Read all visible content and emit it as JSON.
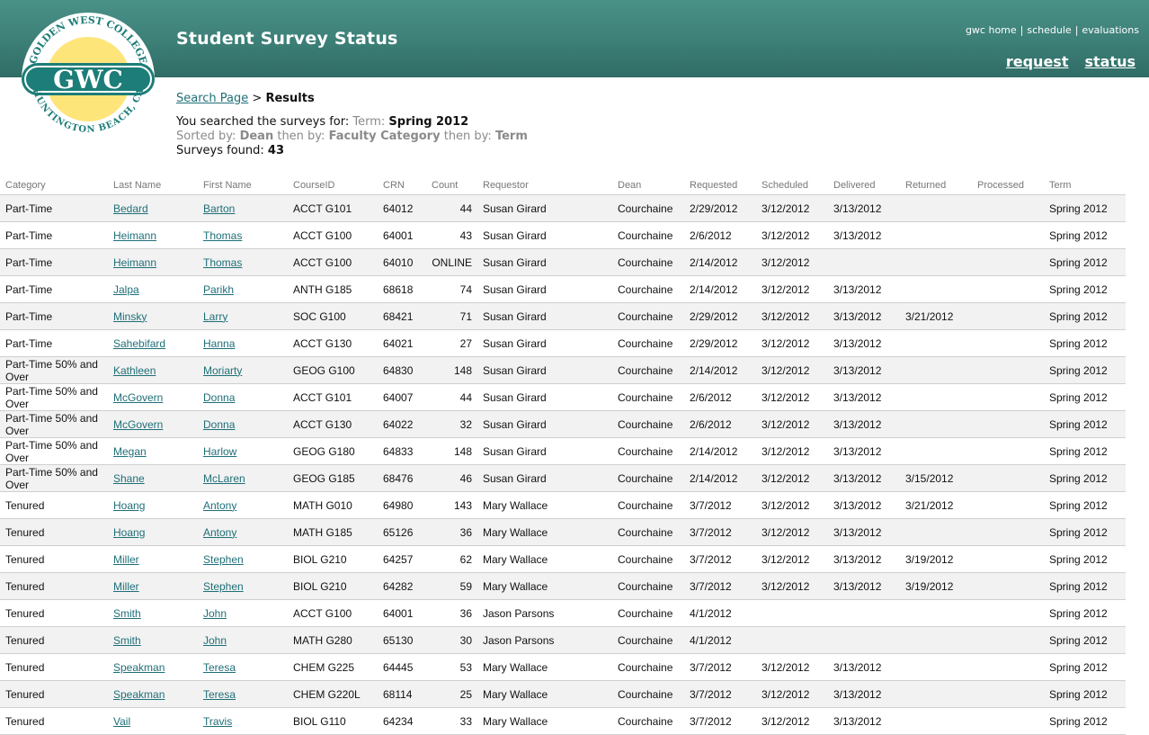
{
  "header": {
    "title": "Student Survey Status",
    "top_links": [
      "gwc home",
      "schedule",
      "evaluations"
    ],
    "top_sep": "|",
    "main_links": [
      "request",
      "status"
    ]
  },
  "logo": {
    "arc_top": "GOLDEN WEST COLLEGE",
    "center": "GWC",
    "arc_bottom": "HUNTINGTON BEACH, CA",
    "colors": {
      "sun": "#fde57a",
      "band": "#1d7d78",
      "ring": "#ffffff"
    }
  },
  "breadcrumb": {
    "link": "Search Page",
    "sep": ">",
    "current": "Results"
  },
  "search_info": {
    "line1_prefix": "You searched the surveys for:",
    "term_label": "Term:",
    "term_value": "Spring 2012",
    "sorted_label": "Sorted by:",
    "sort1": "Dean",
    "then_by1": "then by:",
    "sort2": "Faculty Category",
    "then_by2": "then by:",
    "sort3": "Term",
    "found_label": "Surveys found:",
    "found_value": "43"
  },
  "colors": {
    "banner": "#3c7f77",
    "link": "#1f6f78",
    "row_alt": "#f2f2f2"
  },
  "table": {
    "columns": [
      "Category",
      "Last Name",
      "First Name",
      "CourseID",
      "CRN",
      "Count",
      "Requestor",
      "Dean",
      "Requested",
      "Scheduled",
      "Delivered",
      "Returned",
      "Processed",
      "Term"
    ],
    "rows": [
      [
        "Part-Time",
        "Bedard",
        "Barton",
        "ACCT G101",
        "64012",
        "44",
        "Susan Girard",
        "Courchaine",
        "2/29/2012",
        "3/12/2012",
        "3/13/2012",
        "",
        "",
        "Spring 2012"
      ],
      [
        "Part-Time",
        "Heimann",
        "Thomas",
        "ACCT G100",
        "64001",
        "43",
        "Susan Girard",
        "Courchaine",
        "2/6/2012",
        "3/12/2012",
        "3/13/2012",
        "",
        "",
        "Spring 2012"
      ],
      [
        "Part-Time",
        "Heimann",
        "Thomas",
        "ACCT G100",
        "64010",
        "ONLINE",
        "Susan Girard",
        "Courchaine",
        "2/14/2012",
        "3/12/2012",
        "",
        "",
        "",
        "Spring 2012"
      ],
      [
        "Part-Time",
        "Jalpa",
        "Parikh",
        "ANTH G185",
        "68618",
        "74",
        "Susan Girard",
        "Courchaine",
        "2/14/2012",
        "3/12/2012",
        "3/13/2012",
        "",
        "",
        "Spring 2012"
      ],
      [
        "Part-Time",
        "Minsky",
        "Larry",
        "SOC G100",
        "68421",
        "71",
        "Susan Girard",
        "Courchaine",
        "2/29/2012",
        "3/12/2012",
        "3/13/2012",
        "3/21/2012",
        "",
        "Spring 2012"
      ],
      [
        "Part-Time",
        "Sahebifard",
        "Hanna",
        "ACCT G130",
        "64021",
        "27",
        "Susan Girard",
        "Courchaine",
        "2/29/2012",
        "3/12/2012",
        "3/13/2012",
        "",
        "",
        "Spring 2012"
      ],
      [
        "Part-Time 50% and Over",
        "Kathleen",
        "Moriarty",
        "GEOG G100",
        "64830",
        "148",
        "Susan Girard",
        "Courchaine",
        "2/14/2012",
        "3/12/2012",
        "3/13/2012",
        "",
        "",
        "Spring 2012"
      ],
      [
        "Part-Time 50% and Over",
        "McGovern",
        "Donna",
        "ACCT G101",
        "64007",
        "44",
        "Susan Girard",
        "Courchaine",
        "2/6/2012",
        "3/12/2012",
        "3/13/2012",
        "",
        "",
        "Spring 2012"
      ],
      [
        "Part-Time 50% and Over",
        "McGovern",
        "Donna",
        "ACCT G130",
        "64022",
        "32",
        "Susan Girard",
        "Courchaine",
        "2/6/2012",
        "3/12/2012",
        "3/13/2012",
        "",
        "",
        "Spring 2012"
      ],
      [
        "Part-Time 50% and Over",
        "Megan",
        "Harlow",
        "GEOG G180",
        "64833",
        "148",
        "Susan Girard",
        "Courchaine",
        "2/14/2012",
        "3/12/2012",
        "3/13/2012",
        "",
        "",
        "Spring 2012"
      ],
      [
        "Part-Time 50% and Over",
        "Shane",
        "McLaren",
        "GEOG G185",
        "68476",
        "46",
        "Susan Girard",
        "Courchaine",
        "2/14/2012",
        "3/12/2012",
        "3/13/2012",
        "3/15/2012",
        "",
        "Spring 2012"
      ],
      [
        "Tenured",
        "Hoang",
        "Antony",
        "MATH G010",
        "64980",
        "143",
        "Mary Wallace",
        "Courchaine",
        "3/7/2012",
        "3/12/2012",
        "3/13/2012",
        "3/21/2012",
        "",
        "Spring 2012"
      ],
      [
        "Tenured",
        "Hoang",
        "Antony",
        "MATH G185",
        "65126",
        "36",
        "Mary Wallace",
        "Courchaine",
        "3/7/2012",
        "3/12/2012",
        "3/13/2012",
        "",
        "",
        "Spring 2012"
      ],
      [
        "Tenured",
        "Miller",
        "Stephen",
        "BIOL G210",
        "64257",
        "62",
        "Mary Wallace",
        "Courchaine",
        "3/7/2012",
        "3/12/2012",
        "3/13/2012",
        "3/19/2012",
        "",
        "Spring 2012"
      ],
      [
        "Tenured",
        "Miller",
        "Stephen",
        "BIOL G210",
        "64282",
        "59",
        "Mary Wallace",
        "Courchaine",
        "3/7/2012",
        "3/12/2012",
        "3/13/2012",
        "3/19/2012",
        "",
        "Spring 2012"
      ],
      [
        "Tenured",
        "Smith",
        "John",
        "ACCT G100",
        "64001",
        "36",
        "Jason Parsons",
        "Courchaine",
        "4/1/2012",
        "",
        "",
        "",
        "",
        "Spring 2012"
      ],
      [
        "Tenured",
        "Smith",
        "John",
        "MATH G280",
        "65130",
        "30",
        "Jason Parsons",
        "Courchaine",
        "4/1/2012",
        "",
        "",
        "",
        "",
        "Spring 2012"
      ],
      [
        "Tenured",
        "Speakman",
        "Teresa",
        "CHEM G225",
        "64445",
        "53",
        "Mary Wallace",
        "Courchaine",
        "3/7/2012",
        "3/12/2012",
        "3/13/2012",
        "",
        "",
        "Spring 2012"
      ],
      [
        "Tenured",
        "Speakman",
        "Teresa",
        "CHEM G220L",
        "68114",
        "25",
        "Mary Wallace",
        "Courchaine",
        "3/7/2012",
        "3/12/2012",
        "3/13/2012",
        "",
        "",
        "Spring 2012"
      ],
      [
        "Tenured",
        "Vail",
        "Travis",
        "BIOL G110",
        "64234",
        "33",
        "Mary Wallace",
        "Courchaine",
        "3/7/2012",
        "3/12/2012",
        "3/13/2012",
        "",
        "",
        "Spring 2012"
      ]
    ]
  }
}
